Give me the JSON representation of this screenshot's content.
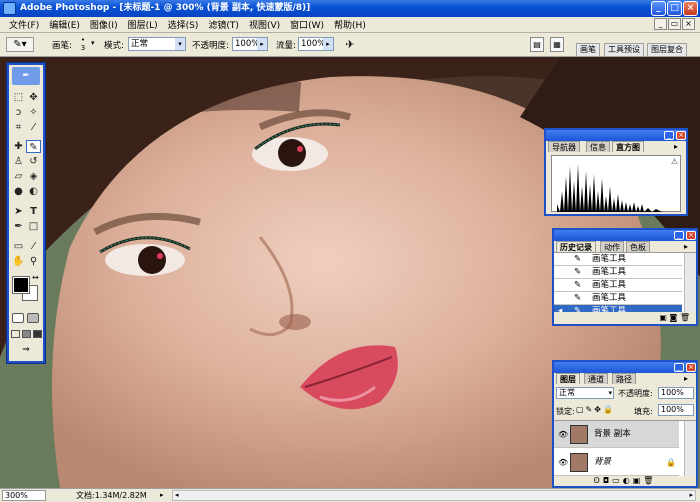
{
  "window": {
    "title": "Adobe Photoshop - [未标题-1 @ 300% (背景 副本, 快速蒙版/8)]"
  },
  "menu": [
    "文件(F)",
    "编辑(E)",
    "图像(I)",
    "图层(L)",
    "选择(S)",
    "滤镜(T)",
    "视图(V)",
    "窗口(W)",
    "帮助(H)"
  ],
  "options": {
    "brush_label": "画笔:",
    "brush_size": "3",
    "mode_label": "模式:",
    "mode_value": "正常",
    "opacity_label": "不透明度:",
    "opacity_value": "100%",
    "flow_label": "流量:",
    "flow_value": "100%"
  },
  "palette_well": [
    "画笔",
    "工具预设",
    "图层复合"
  ],
  "histogram": {
    "tabs": [
      "导航器",
      "信息",
      "直方图"
    ],
    "warning": "⚠"
  },
  "history": {
    "tabs": [
      "历史记录",
      "动作",
      "色板"
    ],
    "items": [
      "画笔工具",
      "画笔工具",
      "画笔工具",
      "画笔工具",
      "画笔工具"
    ],
    "selected_index": 4
  },
  "layers": {
    "tabs": [
      "图层",
      "通道",
      "路径"
    ],
    "blend_mode": "正常",
    "opacity_label": "不透明度:",
    "opacity_value": "100%",
    "lock_label": "锁定:",
    "fill_label": "填充:",
    "fill_value": "100%",
    "items": [
      {
        "name": "背景 副本",
        "selected": true
      },
      {
        "name": "背景",
        "locked": true
      }
    ]
  },
  "status": {
    "zoom": "300%",
    "doc": "文档:1.34M/2.82M"
  },
  "colors": {
    "title_blue": "#0a52d6",
    "panel_border": "#1e50c8",
    "selected": "#316ac5",
    "foreground": "#000000",
    "background": "#ffffff"
  }
}
